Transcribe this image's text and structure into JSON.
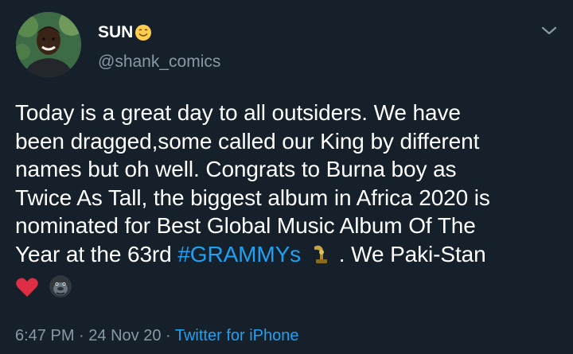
{
  "author": {
    "display_name": "SUN",
    "display_name_emoji": "smiling-face-emoji",
    "handle": "@shank_comics"
  },
  "tweet": {
    "line1": "Today is a great day to all outsiders. We have",
    "line2": "been dragged,some called our King by different",
    "line3": "names but oh well. Congrats to Burna boy as",
    "line4": "Twice As Tall, the biggest album in Africa 2020 is",
    "line5": "nominated for Best Global Music Album Of The",
    "line6_before": "Year at the 63rd ",
    "hashtag": "#GRAMMYs",
    "trophy_emoji": "gramophone-trophy-emoji",
    "line6_after": " . We Paki-Stan",
    "end_emojis": [
      "red-heart-emoji",
      "gorilla-emoji"
    ]
  },
  "meta": {
    "time": "6:47 PM",
    "sep1": " · ",
    "date": "24 Nov 20",
    "sep2": " · ",
    "source": "Twitter for iPhone"
  },
  "colors": {
    "background": "#15202b",
    "text": "#ffffff",
    "secondary": "#8899a6",
    "link": "#1da1f2"
  }
}
